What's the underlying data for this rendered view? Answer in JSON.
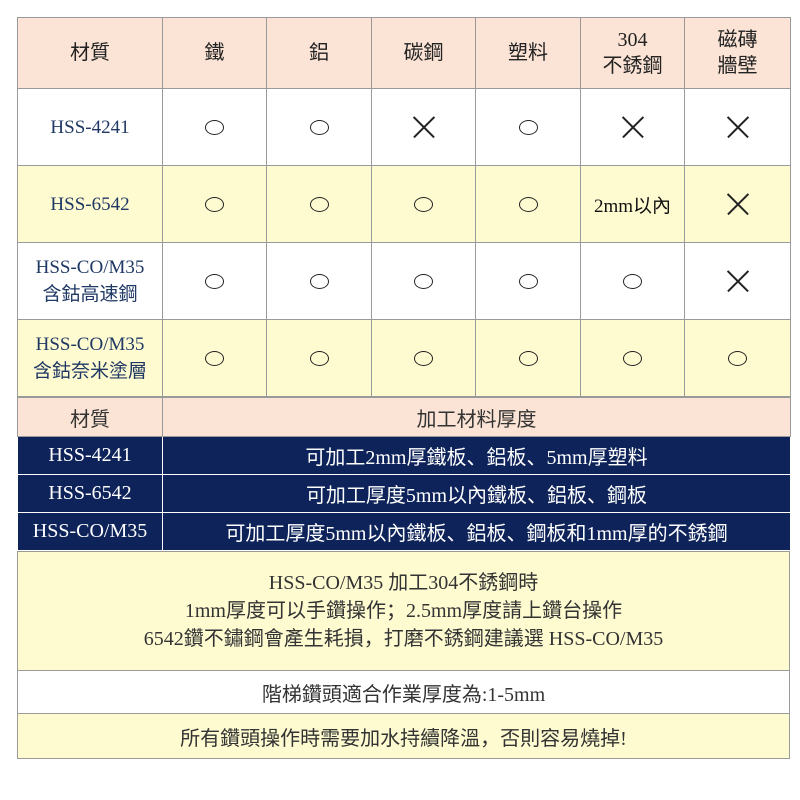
{
  "compat": {
    "header": [
      "材質",
      "鐵",
      "鋁",
      "碳鋼",
      "塑料",
      "304\n不銹鋼",
      "磁磚\n牆壁"
    ],
    "rows": [
      {
        "name": [
          "HSS-4241"
        ],
        "cells": [
          "○",
          "○",
          "×",
          "○",
          "×",
          "×"
        ]
      },
      {
        "name": [
          "HSS-6542"
        ],
        "cells": [
          "○",
          "○",
          "○",
          "○",
          "2mm以內",
          "×"
        ]
      },
      {
        "name": [
          "HSS-CO/M35",
          "含鈷高速鋼"
        ],
        "cells": [
          "○",
          "○",
          "○",
          "○",
          "○",
          "×"
        ]
      },
      {
        "name": [
          "HSS-CO/M35",
          "含鈷奈米塗層"
        ],
        "cells": [
          "○",
          "○",
          "○",
          "○",
          "○",
          "○"
        ]
      }
    ]
  },
  "thickness": {
    "header": [
      "材質",
      "加工材料厚度"
    ],
    "rows": [
      [
        "HSS-4241",
        "可加工2mm厚鐵板、鋁板、5mm厚塑料"
      ],
      [
        "HSS-6542",
        "可加工厚度5mm以內鐵板、鋁板、鋼板"
      ],
      [
        "HSS-CO/M35",
        "可加工厚度5mm以內鐵板、鋁板、鋼板和1mm厚的不銹鋼"
      ]
    ]
  },
  "notes": {
    "block": [
      "HSS-CO/M35 加工304不銹鋼時",
      "1mm厚度可以手鑽操作；2.5mm厚度請上鑽台操作",
      "6542鑽不鏽鋼會產生耗損，打磨不銹鋼建議選 HSS-CO/M35"
    ],
    "step": "階梯鑽頭適合作業厚度為:1-5mm",
    "warning": "所有鑽頭操作時需要加水持續降溫，否則容易燒掉!"
  }
}
